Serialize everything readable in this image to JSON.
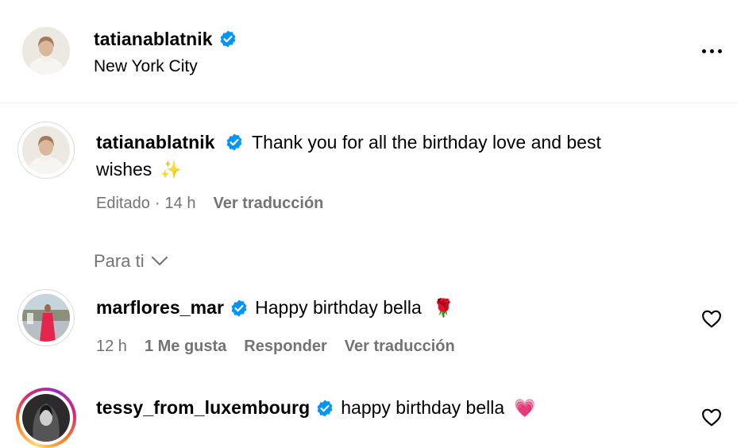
{
  "header": {
    "username": "tatianablatnik",
    "location": "New York City",
    "more_label": "•••"
  },
  "caption": {
    "username": "tatianablatnik",
    "text_line1": "Thank you for all the birthday love and best",
    "text_line2": "wishes",
    "emoji": "✨",
    "edited": "Editado",
    "separator": "·",
    "time": "14 h",
    "translate": "Ver traducción"
  },
  "filter": {
    "label": "Para ti"
  },
  "comments": [
    {
      "username": "marflores_mar",
      "text": "Happy birthday bella",
      "emoji": "🌹",
      "time": "12 h",
      "likes": "1 Me gusta",
      "reply": "Responder",
      "translate": "Ver traducción"
    },
    {
      "username": "tessy_from_luxembourg",
      "text": "happy birthday bella",
      "emoji": "💗"
    }
  ],
  "colors": {
    "verified": "#0095f6",
    "meta": "#737373",
    "divider": "#efefef"
  }
}
